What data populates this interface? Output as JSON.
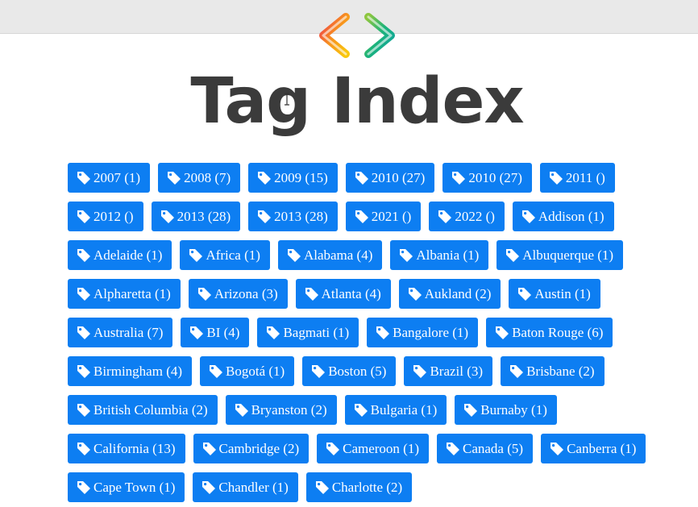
{
  "header": {
    "title": "Tag Index"
  },
  "colors": {
    "tag_bg": "#0d7ef2",
    "title": "#3b3b3b",
    "topbar": "#e9e9e9"
  },
  "icons": {
    "logo": "code-brackets-logo",
    "tag": "tag-icon"
  },
  "tags": [
    "2007 (1)",
    "2008 (7)",
    "2009 (15)",
    "2010 (27)",
    "2010 (27)",
    "2011 ()",
    "2012 ()",
    "2013 (28)",
    "2013 (28)",
    "2021 ()",
    "2022 ()",
    "Addison (1)",
    "Adelaide (1)",
    "Africa (1)",
    "Alabama (4)",
    "Albania (1)",
    "Albuquerque (1)",
    "Alpharetta (1)",
    "Arizona (3)",
    "Atlanta (4)",
    "Aukland (2)",
    "Austin (1)",
    "Australia (7)",
    "BI (4)",
    "Bagmati (1)",
    "Bangalore (1)",
    "Baton Rouge (6)",
    "Birmingham (4)",
    "Bogotá (1)",
    "Boston (5)",
    "Brazil (3)",
    "Brisbane (2)",
    "British Columbia (2)",
    "Bryanston (2)",
    "Bulgaria (1)",
    "Burnaby (1)",
    "California (13)",
    "Cambridge (2)",
    "Cameroon (1)",
    "Canada (5)",
    "Canberra (1)",
    "Cape Town (1)",
    "Chandler (1)",
    "Charlotte (2)"
  ]
}
